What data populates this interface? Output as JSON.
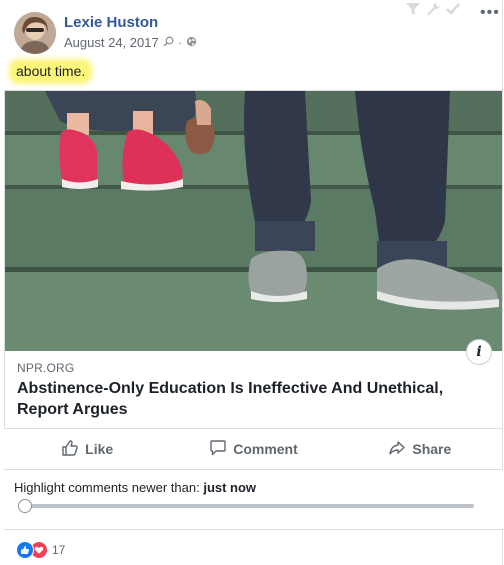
{
  "post": {
    "author": "Lexie Huston",
    "date": "August 24, 2017",
    "status_text": "about time.",
    "icons": [
      "privacy-public-icon",
      "search-icon",
      "filter-icon",
      "wrench-icon",
      "check-icon",
      "more-options-icon"
    ]
  },
  "link_card": {
    "domain": "NPR.ORG",
    "headline": "Abstinence-Only Education Is Ineffective And Unethical, Report Argues",
    "image_alt": "teens sitting on green steps, sneakers"
  },
  "actions": {
    "like_label": "Like",
    "comment_label": "Comment",
    "share_label": "Share"
  },
  "highlight": {
    "label": "Highlight comments newer than:",
    "value": "just now",
    "slider_position": 0
  },
  "reactions": {
    "types": [
      "like",
      "love"
    ],
    "count": "17"
  },
  "colors": {
    "name_link": "#365899",
    "highlight_marker": "#fbf57a",
    "like_blue": "#1877f2",
    "love_red": "#f33e58"
  }
}
